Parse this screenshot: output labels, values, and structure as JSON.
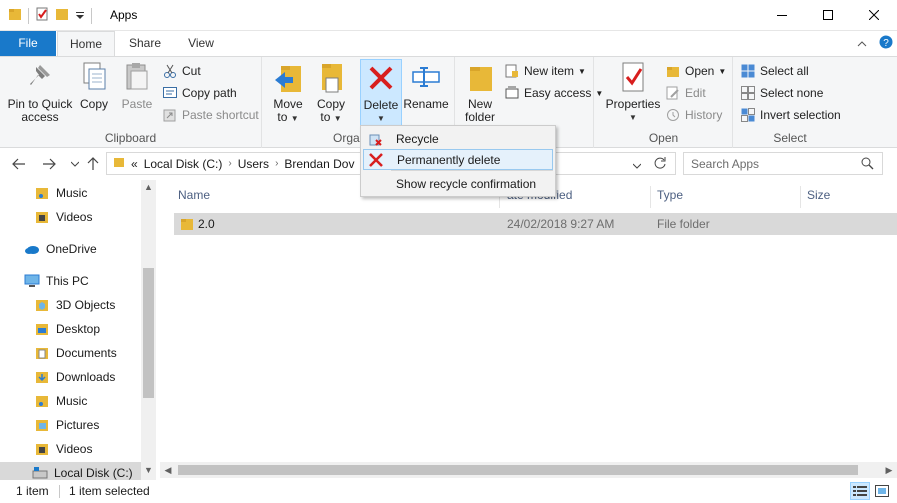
{
  "window": {
    "title": "Apps"
  },
  "tabs": {
    "file": "File",
    "home": "Home",
    "share": "Share",
    "view": "View"
  },
  "ribbon": {
    "clipboard": {
      "label": "Clipboard",
      "pin_label_1": "Pin to Quick",
      "pin_label_2": "access",
      "copy": "Copy",
      "paste": "Paste",
      "cut": "Cut",
      "copy_path": "Copy path",
      "paste_shortcut": "Paste shortcut"
    },
    "organize": {
      "label": "Orga",
      "move_1": "Move",
      "move_2": "to",
      "copy_1": "Copy",
      "copy_2": "to",
      "delete": "Delete",
      "rename": "Rename"
    },
    "new": {
      "new_folder_1": "New",
      "new_folder_2": "folder",
      "new_item": "New item",
      "easy_access": "Easy access"
    },
    "open": {
      "label": "Open",
      "properties": "Properties",
      "open": "Open",
      "edit": "Edit",
      "history": "History"
    },
    "select": {
      "label": "Select",
      "select_all": "Select all",
      "select_none": "Select none",
      "invert": "Invert selection"
    }
  },
  "address": {
    "prefix": "«",
    "crumbs": [
      "Local Disk (C:)",
      "Users",
      "Brendan Dov"
    ]
  },
  "search": {
    "placeholder": "Search Apps"
  },
  "nav": {
    "items": [
      {
        "label": "Music",
        "icon": "music-folder-icon"
      },
      {
        "label": "Videos",
        "icon": "videos-folder-icon"
      },
      {
        "label": "OneDrive",
        "icon": "cloud-icon"
      },
      {
        "label": "This PC",
        "icon": "computer-icon"
      },
      {
        "label": "3D Objects",
        "icon": "3d-objects-icon"
      },
      {
        "label": "Desktop",
        "icon": "desktop-folder-icon"
      },
      {
        "label": "Documents",
        "icon": "documents-folder-icon"
      },
      {
        "label": "Downloads",
        "icon": "downloads-folder-icon"
      },
      {
        "label": "Music",
        "icon": "music-folder-icon"
      },
      {
        "label": "Pictures",
        "icon": "pictures-folder-icon"
      },
      {
        "label": "Videos",
        "icon": "videos-folder-icon"
      },
      {
        "label": "Local Disk (C:)",
        "icon": "drive-icon"
      }
    ]
  },
  "columns": {
    "name": "Name",
    "date": "ate modified",
    "type": "Type",
    "size": "Size"
  },
  "files": [
    {
      "name": "2.0",
      "date": "24/02/2018 9:27 AM",
      "type": "File folder"
    }
  ],
  "menu": {
    "recycle": "Recycle",
    "permanently_delete": "Permanently delete",
    "show_confirmation": "Show recycle confirmation"
  },
  "status": {
    "count": "1 item",
    "selected": "1 item selected"
  },
  "colors": {
    "accent": "#1979ca",
    "folder": "#e8b838",
    "delete_red": "#d81e1e"
  }
}
